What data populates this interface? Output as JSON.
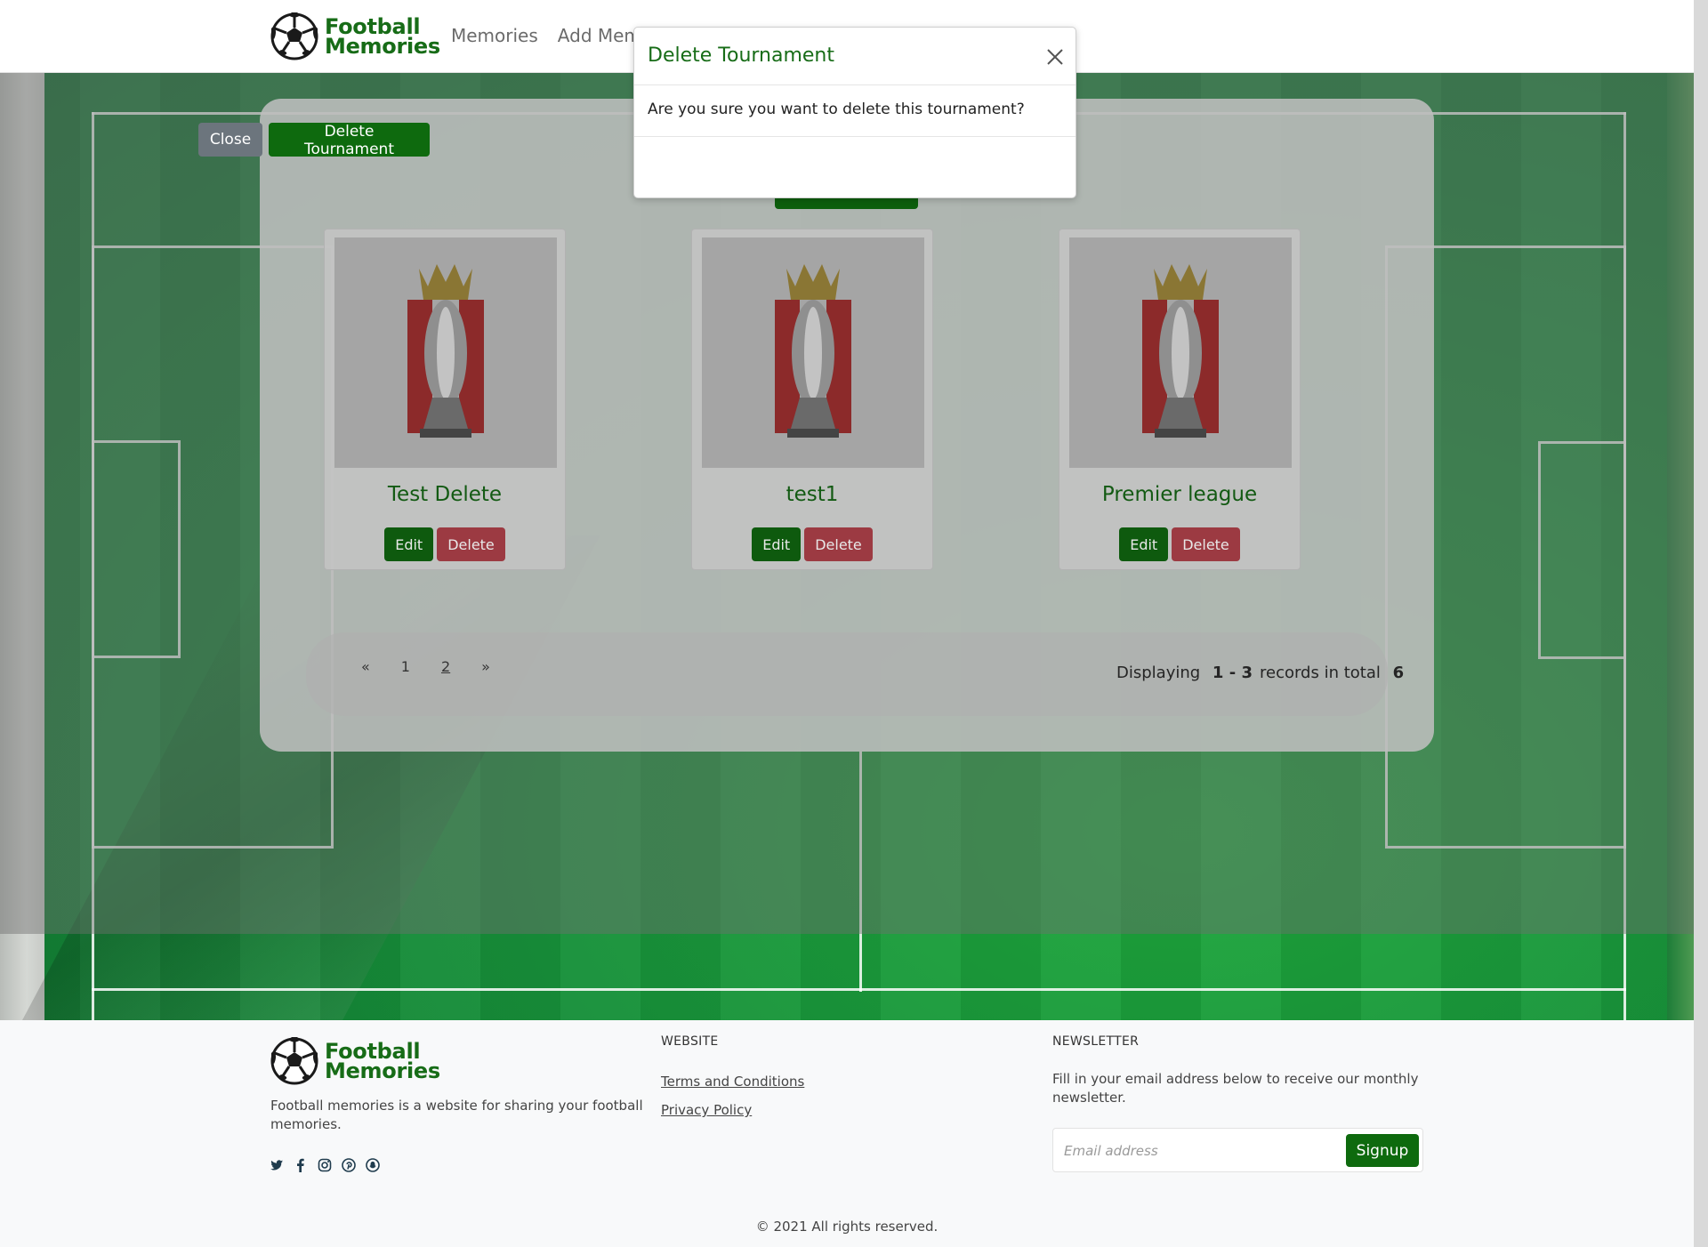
{
  "header": {
    "brand_line1": "Football",
    "brand_line2": "Memories",
    "nav": [
      "Memories",
      "Add Mem"
    ]
  },
  "modal": {
    "title": "Delete Tournament",
    "message": "Are you sure you want to delete this tournament?",
    "close_label": "Close",
    "confirm_label": "Delete Tournament"
  },
  "cards": [
    {
      "title": "Test Delete",
      "edit_label": "Edit",
      "delete_label": "Delete"
    },
    {
      "title": "test1",
      "edit_label": "Edit",
      "delete_label": "Delete"
    },
    {
      "title": "Premier league",
      "edit_label": "Edit",
      "delete_label": "Delete"
    }
  ],
  "pagination": {
    "prev": "«",
    "pages": [
      "1",
      "2"
    ],
    "next": "»",
    "current_page": "2",
    "records_prefix": "Displaying",
    "records_range": "1 - 3",
    "records_mid": "records in total",
    "records_total": "6"
  },
  "footer": {
    "brand_line1": "Football",
    "brand_line2": "Memories",
    "description": "Football memories is a website for sharing your football memories.",
    "social_icons": [
      "twitter-icon",
      "facebook-icon",
      "instagram-icon",
      "pinterest-icon",
      "snapchat-icon"
    ],
    "website_heading": "WEBSITE",
    "terms_label": "Terms and Conditions",
    "privacy_label": "Privacy Policy",
    "newsletter_heading": "NEWSLETTER",
    "newsletter_text": "Fill in your email address below to receive our monthly newsletter.",
    "email_placeholder": "Email address",
    "signup_label": "Signup",
    "copyright": "© 2021 All rights reserved."
  },
  "colors": {
    "brand_green": "#176c17",
    "delete_red": "#dc3545",
    "close_gray": "#6c757d"
  }
}
